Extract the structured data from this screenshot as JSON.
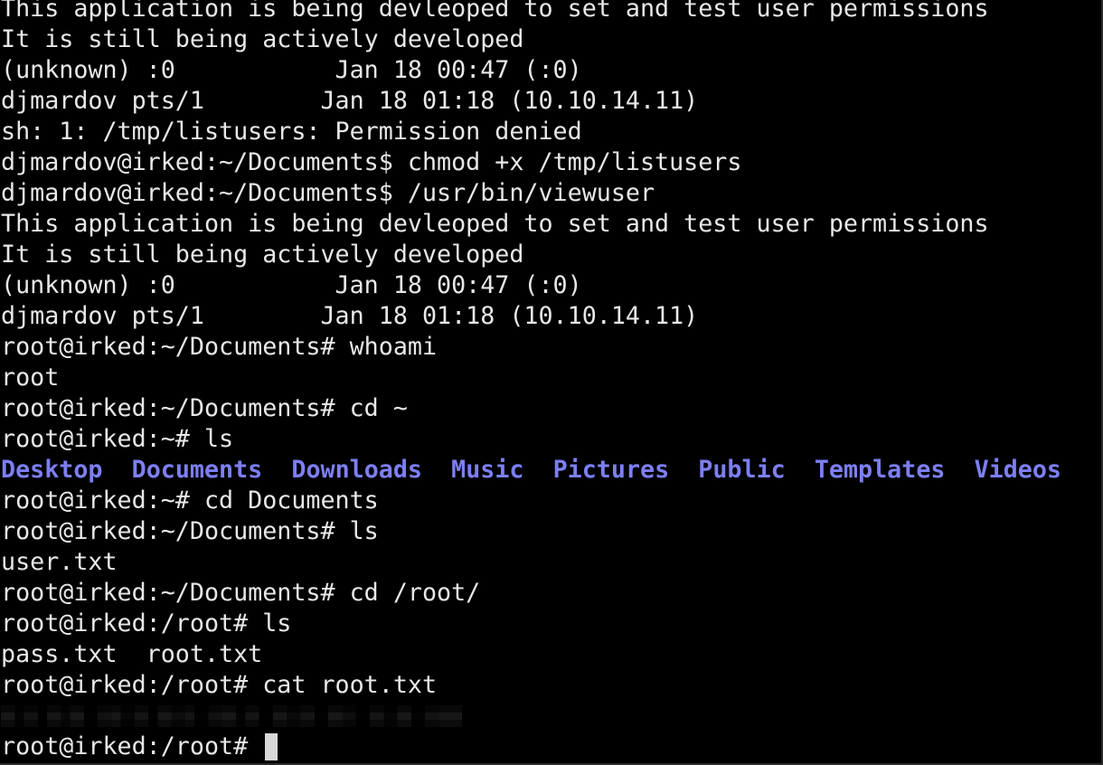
{
  "terminal": {
    "lines": [
      "This application is being devleoped to set and test user permissions",
      "It is still being actively developed",
      "(unknown) :0           Jan 18 00:47 (:0)",
      "djmardov pts/1        Jan 18 01:18 (10.10.14.11)",
      "sh: 1: /tmp/listusers: Permission denied",
      "djmardov@irked:~/Documents$ chmod +x /tmp/listusers",
      "djmardov@irked:~/Documents$ /usr/bin/viewuser",
      "This application is being devleoped to set and test user permissions",
      "It is still being actively developed",
      "(unknown) :0           Jan 18 00:47 (:0)",
      "djmardov pts/1        Jan 18 01:18 (10.10.14.11)",
      "root@irked:~/Documents# whoami",
      "root",
      "root@irked:~/Documents# cd ~",
      "root@irked:~# ls"
    ],
    "ls_dirs": [
      "Desktop",
      "Documents",
      "Downloads",
      "Music",
      "Pictures",
      "Public",
      "Templates",
      "Videos"
    ],
    "lines_after": [
      "root@irked:~# cd Documents",
      "root@irked:~/Documents# ls",
      "user.txt",
      "root@irked:~/Documents# cd /root/",
      "root@irked:/root# ls",
      "pass.txt  root.txt",
      "root@irked:/root# cat root.txt"
    ],
    "prompt": "root@irked:/root# "
  },
  "colors": {
    "background": "#000000",
    "foreground": "#e8e8e8",
    "directory": "#7d7ff2"
  }
}
